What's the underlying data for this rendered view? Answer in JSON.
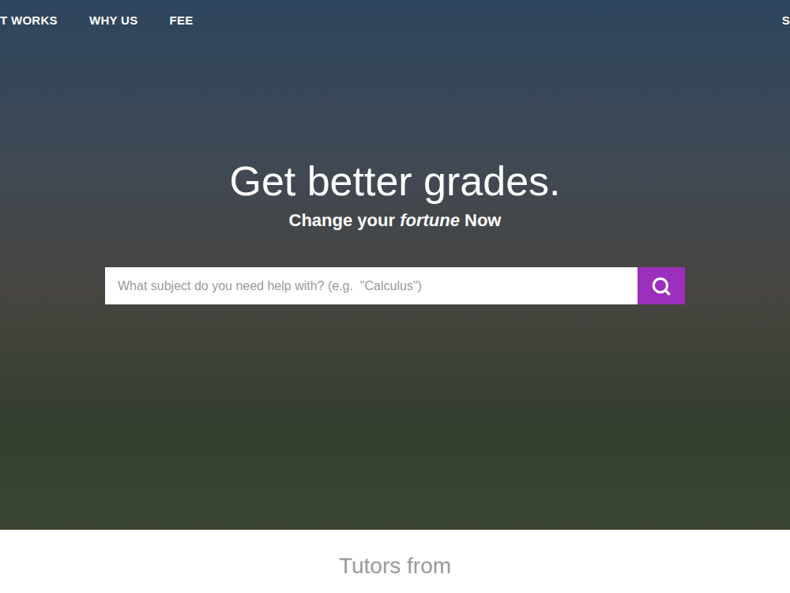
{
  "nav": {
    "left_items": [
      "T WORKS",
      "WHY US",
      "FEE"
    ],
    "right_items": [
      "S"
    ]
  },
  "hero": {
    "title": "Get better grades.",
    "subtitle": {
      "prefix": "Change your ",
      "emphasis": "fortune",
      "suffix": " Now"
    }
  },
  "search": {
    "placeholder": "What subject do you need help with? (e.g.  \"Calculus\")"
  },
  "section": {
    "heading": "Tutors from"
  }
}
